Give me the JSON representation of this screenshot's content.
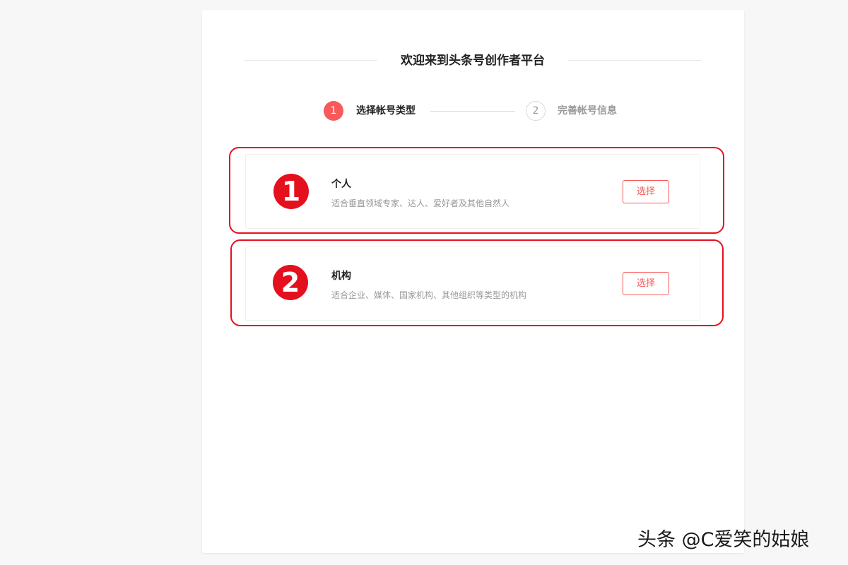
{
  "header": {
    "title": "欢迎来到头条号创作者平台"
  },
  "stepper": {
    "steps": [
      {
        "number": "1",
        "label": "选择帐号类型"
      },
      {
        "number": "2",
        "label": "完善帐号信息"
      }
    ],
    "active_step": 1
  },
  "options": [
    {
      "title": "个人",
      "description": "适合垂直领域专家、达人、爱好者及其他自然人",
      "button_label": "选择"
    },
    {
      "title": "机构",
      "description": "适合企业、媒体、国家机构、其他组织等类型的机构",
      "button_label": "选择"
    }
  ],
  "annotations": {
    "badges": [
      "❶",
      "❷"
    ]
  },
  "watermark": "头条 @C爱笑的姑娘",
  "colors": {
    "accent": "#f85959",
    "annotation": "#e5101d",
    "background": "#f7f7f7"
  }
}
